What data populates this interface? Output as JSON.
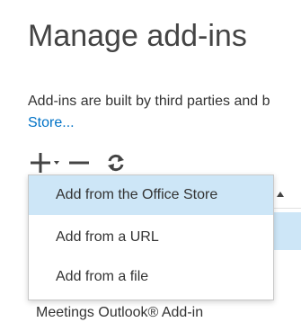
{
  "page": {
    "title": "Manage add-ins",
    "description": "Add-ins are built by third parties and b",
    "store_link": "Store..."
  },
  "toolbar": {
    "add_icon": "plus-icon",
    "remove_icon": "minus-icon",
    "refresh_icon": "refresh-icon"
  },
  "dropdown": {
    "items": [
      {
        "label": "Add from the Office Store",
        "highlighted": true
      },
      {
        "label": "Add from a URL",
        "highlighted": false
      },
      {
        "label": "Add from a file",
        "highlighted": false
      }
    ]
  },
  "table": {
    "peek_row": "Meetings Outlook® Add-in"
  },
  "colors": {
    "link": "#0072c6",
    "highlight": "#cde6f7",
    "icon": "#444444"
  }
}
